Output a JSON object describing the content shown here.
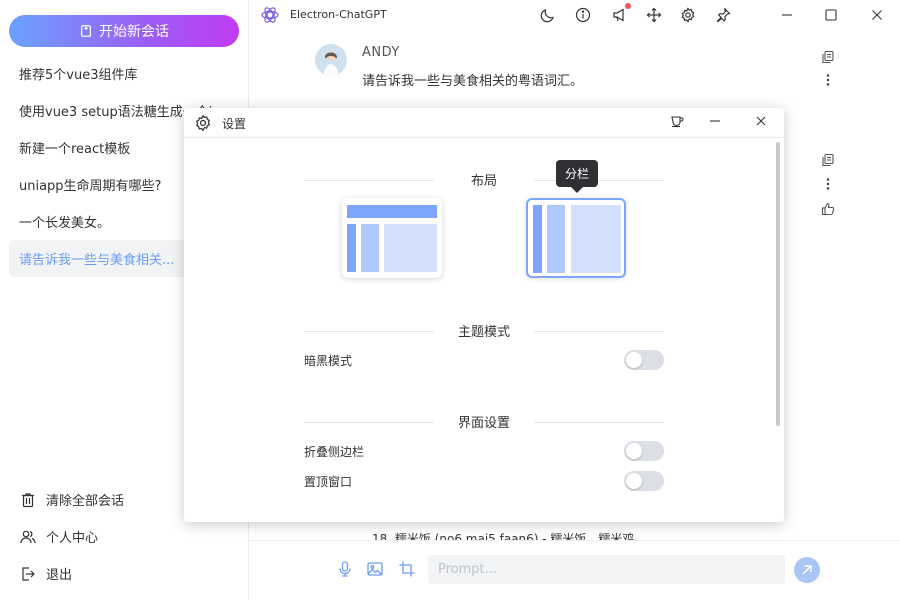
{
  "app": {
    "title": "Electron-ChatGPT"
  },
  "sidebar": {
    "new_chat_label": "开始新会话",
    "conversations": [
      {
        "label": "推荐5个vue3组件库"
      },
      {
        "label": "使用vue3 setup语法糖生成一个i..."
      },
      {
        "label": "新建一个react模板"
      },
      {
        "label": "uniapp生命周期有哪些?"
      },
      {
        "label": "一个长发美女。"
      },
      {
        "label": "请告诉我一些与美食相关..."
      }
    ],
    "bottom_links": [
      {
        "label": "清除全部会话",
        "icon": "trash-icon"
      },
      {
        "label": "个人中心",
        "icon": "users-icon"
      },
      {
        "label": "退出",
        "icon": "logout-icon"
      }
    ]
  },
  "chat": {
    "user_name": "ANDY",
    "user_message": "请告诉我一些与美食相关的粤语词汇。",
    "partial_text": "18. 糯米饭 (no6 mai5 faan6) - 糯米饭，糯米鸡"
  },
  "input": {
    "placeholder": "Prompt..."
  },
  "settings": {
    "title": "设置",
    "layout_section": "布局",
    "layout_tooltip": "分栏",
    "theme_section": "主题模式",
    "dark_mode_label": "暗黑模式",
    "ui_section": "界面设置",
    "collapse_sidebar_label": "折叠侧边栏",
    "pin_window_label": "置顶窗口",
    "toggles": {
      "dark_mode": false,
      "collapse_sidebar": false,
      "pin_window": false
    }
  },
  "colors": {
    "accent": "#6c9cf6",
    "layout_dark": "#7ea6ff",
    "layout_mid": "#adc8fb",
    "layout_light": "#d3e0fc",
    "toggle_off": "#dcdfe6",
    "notification": "#f5555a"
  }
}
